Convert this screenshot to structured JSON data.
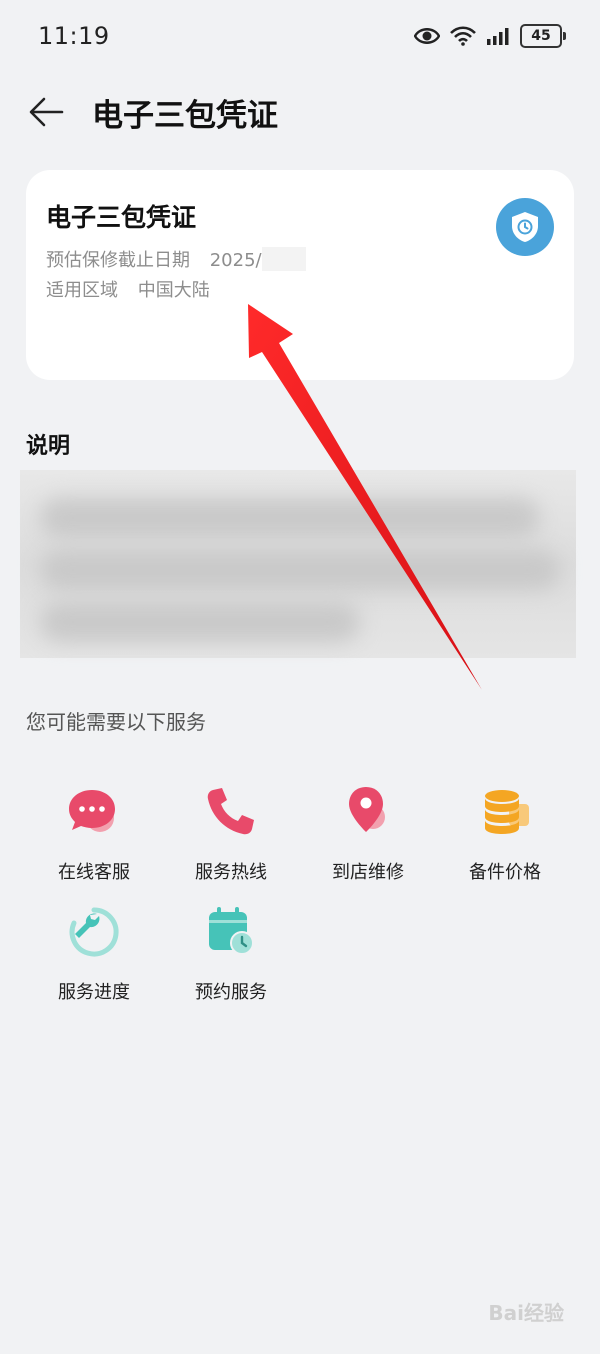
{
  "status_bar": {
    "time": "11:19",
    "battery": "45"
  },
  "header": {
    "title": "电子三包凭证"
  },
  "card": {
    "title": "电子三包凭证",
    "warranty_label": "预估保修截止日期",
    "warranty_value": "2025/",
    "region_label": "适用区域",
    "region_value": "中国大陆"
  },
  "explanation": {
    "title": "说明"
  },
  "services": {
    "title": "您可能需要以下服务",
    "items": [
      {
        "label": "在线客服",
        "icon": "chat-bubbles-icon",
        "color": "#e84a6a"
      },
      {
        "label": "服务热线",
        "icon": "phone-icon",
        "color": "#e84a6a"
      },
      {
        "label": "到店维修",
        "icon": "location-pin-icon",
        "color": "#e84a6a"
      },
      {
        "label": "备件价格",
        "icon": "coins-stack-icon",
        "color": "#f4a623"
      },
      {
        "label": "服务进度",
        "icon": "wrench-progress-icon",
        "color": "#46c3b8"
      },
      {
        "label": "预约服务",
        "icon": "calendar-clock-icon",
        "color": "#46c3b8"
      }
    ]
  },
  "colors": {
    "accent_blue": "#4aa3da",
    "annotation_red": "#e5141b"
  },
  "watermark": "Bai经验"
}
